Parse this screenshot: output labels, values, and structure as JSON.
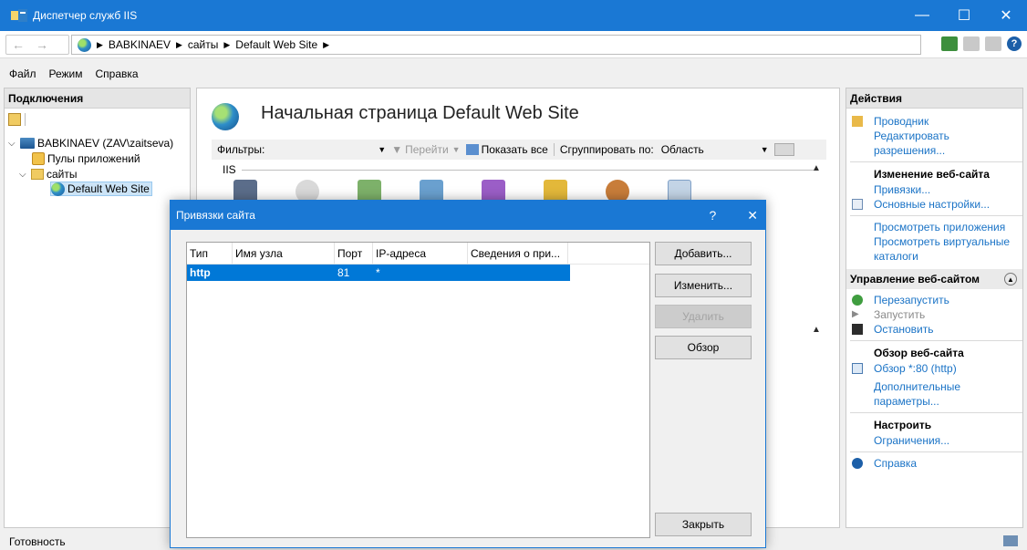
{
  "window": {
    "title": "Диспетчер служб IIS",
    "minimize": "—",
    "maximize": "☐",
    "close": "✕"
  },
  "address": {
    "crumbs": [
      "BABKINAEV",
      "сайты",
      "Default Web Site"
    ]
  },
  "menu": [
    "Файл",
    "Режим",
    "Справка"
  ],
  "connections": {
    "title": "Подключения",
    "tree": {
      "server": "BABKINAEV (ZAV\\zaitseva)",
      "pools": "Пулы приложений",
      "sites": "сайты",
      "site": "Default Web Site"
    }
  },
  "center": {
    "title": "Начальная страница Default Web Site",
    "filter_label": "Фильтры:",
    "go_label": "Перейти",
    "show_all_label": "Показать все",
    "group_by_label": "Сгруппировать по:",
    "group_by_value": "Область",
    "section": "IIS"
  },
  "actions": {
    "title": "Действия",
    "explore": "Проводник",
    "edit_permissions": "Редактировать разрешения...",
    "edit_site_title": "Изменение веб-сайта",
    "bindings": "Привязки...",
    "basic_settings": "Основные настройки...",
    "view_apps": "Просмотреть приложения",
    "view_vdirs": "Просмотреть виртуальные каталоги",
    "manage_title": "Управление веб-сайтом",
    "restart": "Перезапустить",
    "start": "Запустить",
    "stop": "Остановить",
    "browse_title": "Обзор веб-сайта",
    "browse_80": "Обзор *:80 (http)",
    "advanced": "Дополнительные параметры...",
    "configure_title": "Настроить",
    "limits": "Ограничения...",
    "help": "Справка"
  },
  "status": "Готовность",
  "dialog": {
    "title": "Привязки сайта",
    "help": "?",
    "close_x": "✕",
    "columns": [
      "Тип",
      "Имя узла",
      "Порт",
      "IP-адреса",
      "Сведения о при..."
    ],
    "rows": [
      {
        "type": "http",
        "host": "",
        "port": "81",
        "ip": "*",
        "info": ""
      }
    ],
    "buttons": {
      "add": "Добавить...",
      "edit": "Изменить...",
      "remove": "Удалить",
      "browse": "Обзор",
      "close": "Закрыть"
    }
  }
}
